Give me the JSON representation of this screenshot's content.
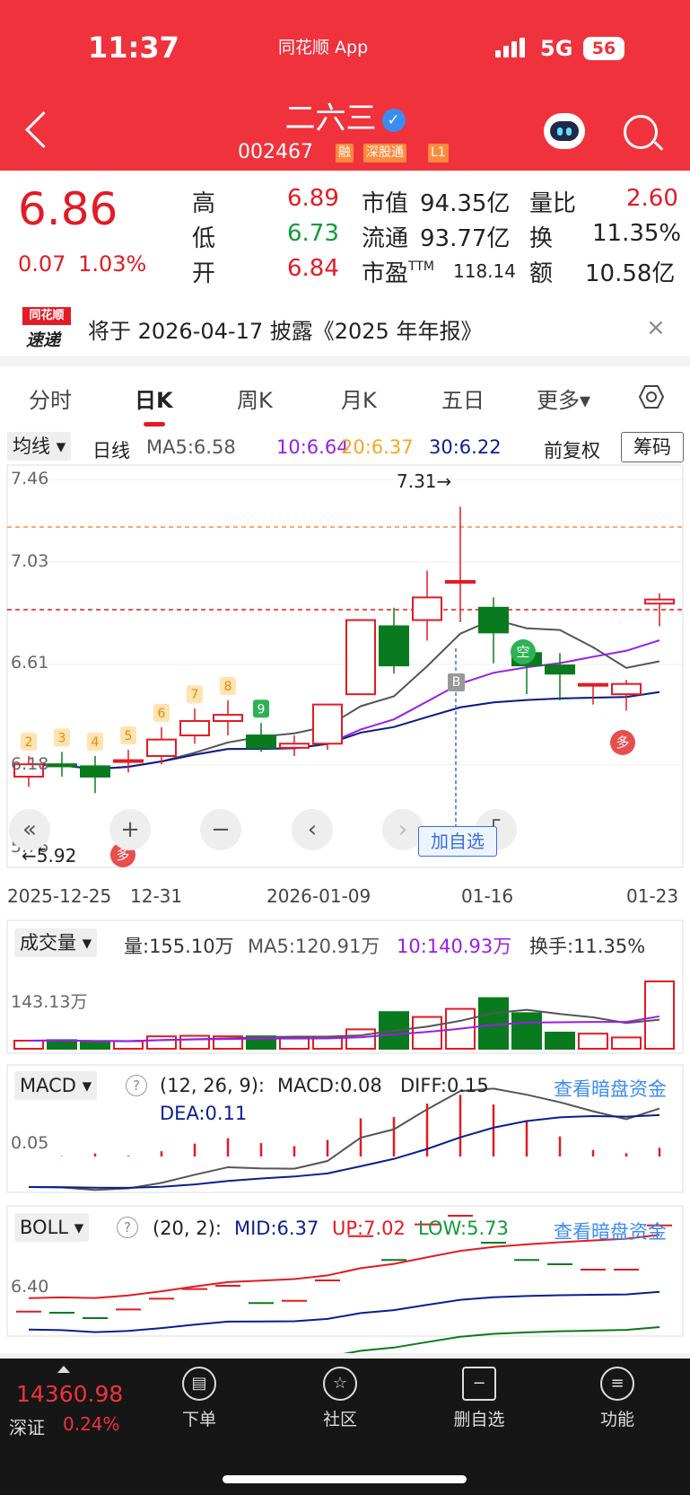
{
  "status_bar": {
    "time": "11:37",
    "app": "同花顺 App",
    "network": "5G",
    "battery": "56"
  },
  "header": {
    "title": "二六三",
    "code": "002467",
    "tags": [
      "融",
      "深股通",
      "L1"
    ],
    "verified_mark": "✓"
  },
  "quote": {
    "price": "6.86",
    "change": "0.07",
    "change_pct": "1.03%",
    "fields": [
      {
        "label": "高",
        "value": "6.89",
        "color": "red"
      },
      {
        "label": "低",
        "value": "6.73",
        "color": "green"
      },
      {
        "label": "开",
        "value": "6.84",
        "color": "red"
      },
      {
        "label": "市值",
        "value": "94.35亿"
      },
      {
        "label": "流通",
        "value": "93.77亿"
      },
      {
        "label": "市盈",
        "suffix": "TTM",
        "value": "118.14"
      },
      {
        "label": "量比",
        "value": "2.60",
        "color": "red"
      },
      {
        "label": "换",
        "value": "11.35%"
      },
      {
        "label": "额",
        "value": "10.58亿"
      }
    ]
  },
  "notice": {
    "logo_top": "同花顺",
    "logo_bottom": "速递",
    "text": "将于 2026-04-17 披露《2025 年年报》",
    "close": "×"
  },
  "tabs": [
    "分时",
    "日K",
    "周K",
    "月K",
    "五日",
    "更多▾"
  ],
  "kline": {
    "indicator_label": "均线 ▾",
    "period": "日线",
    "ma5": "MA5:6.58",
    "ma10": "10:6.64",
    "ma20": "20:6.37",
    "ma30": "30:6.22",
    "adjust": "前复权",
    "chips": "筹码",
    "y_labels": [
      "7.46",
      "7.03",
      "6.61",
      "6.18",
      "5.76"
    ],
    "x_labels": [
      "2025-12-25",
      "12-31",
      "2026-01-09",
      "01-16",
      "01-23"
    ],
    "high_mark": "7.31→",
    "low_mark": "←5.92",
    "add_watch": "加自选",
    "b_mark": "B",
    "kong": "空",
    "duo": "多",
    "markers": [
      "2",
      "3",
      "4",
      "5",
      "6",
      "7",
      "8",
      "9"
    ],
    "colors": {
      "up": "#e21b24",
      "down": "#0a7a1e",
      "ma5": "#555555",
      "ma10": "#9b1de6",
      "ma20": "#f5a623",
      "ma30": "#0a1f8f"
    }
  },
  "chart_data": [
    {
      "type": "candlestick",
      "title": "日K",
      "x": [
        "2025-12-25",
        "2025-12-26",
        "2025-12-29",
        "2025-12-30",
        "2025-12-31",
        "2026-01-05",
        "2026-01-06",
        "2026-01-07",
        "2026-01-08",
        "2026-01-09",
        "2026-01-12",
        "2026-01-13",
        "2026-01-14",
        "2026-01-15",
        "2026-01-16",
        "2026-01-19",
        "2026-01-20",
        "2026-01-21",
        "2026-01-22",
        "2026-01-23"
      ],
      "open": [
        6.0,
        6.06,
        6.05,
        6.08,
        6.1,
        6.2,
        6.27,
        6.2,
        6.14,
        6.16,
        6.4,
        6.73,
        6.76,
        6.95,
        6.82,
        6.6,
        6.54,
        6.45,
        6.4,
        6.84
      ],
      "close": [
        6.06,
        6.05,
        6.0,
        6.08,
        6.18,
        6.27,
        6.3,
        6.14,
        6.16,
        6.35,
        6.76,
        6.54,
        6.87,
        6.95,
        6.7,
        6.54,
        6.5,
        6.45,
        6.45,
        6.86
      ],
      "high": [
        6.1,
        6.12,
        6.1,
        6.13,
        6.24,
        6.33,
        6.37,
        6.26,
        6.2,
        6.35,
        6.76,
        6.82,
        7.0,
        7.31,
        6.87,
        6.6,
        6.6,
        6.45,
        6.47,
        6.89
      ],
      "low": [
        5.95,
        6.0,
        5.92,
        6.02,
        6.06,
        6.16,
        6.2,
        6.12,
        6.1,
        6.13,
        6.4,
        6.5,
        6.66,
        6.75,
        6.55,
        6.4,
        6.37,
        6.35,
        6.32,
        6.73
      ],
      "ylim": [
        5.76,
        7.46
      ]
    },
    {
      "type": "bar",
      "title": "成交量",
      "categories": [
        "2025-12-25",
        "2025-12-26",
        "2025-12-29",
        "2025-12-30",
        "2025-12-31",
        "2026-01-05",
        "2026-01-06",
        "2026-01-07",
        "2026-01-08",
        "2026-01-09",
        "2026-01-12",
        "2026-01-13",
        "2026-01-14",
        "2026-01-15",
        "2026-01-16",
        "2026-01-19",
        "2026-01-20",
        "2026-01-21",
        "2026-01-22",
        "2026-01-23"
      ],
      "values": [
        15,
        16,
        12,
        14,
        23,
        24,
        23,
        23,
        20,
        22,
        36,
        68,
        59,
        74,
        94,
        66,
        30,
        28,
        21,
        125
      ],
      "unit": "万"
    }
  ],
  "volume": {
    "label": "成交量 ▾",
    "vol": "量:155.10万",
    "ma5": "MA5:120.91万",
    "ma10": "10:140.93万",
    "turnover": "换手:11.35%",
    "y_label": "143.13万"
  },
  "macd": {
    "label": "MACD ▾",
    "params": "(12, 26, 9):",
    "macd": "MACD:0.08",
    "diff": "DIFF:0.15",
    "dea": "DEA:0.11",
    "link": "查看暗盘资金",
    "y_label": "0.05"
  },
  "boll": {
    "label": "BOLL ▾",
    "params": "(20, 2):",
    "mid": "MID:6.37",
    "up": "UP:7.02",
    "low": "LOW:5.73",
    "link": "查看暗盘资金",
    "y_label": "6.40"
  },
  "bottom": {
    "index_value": "14360.98",
    "index_name": "深证",
    "index_pct": "0.24%",
    "nav": [
      "下单",
      "社区",
      "删自选",
      "功能"
    ]
  }
}
